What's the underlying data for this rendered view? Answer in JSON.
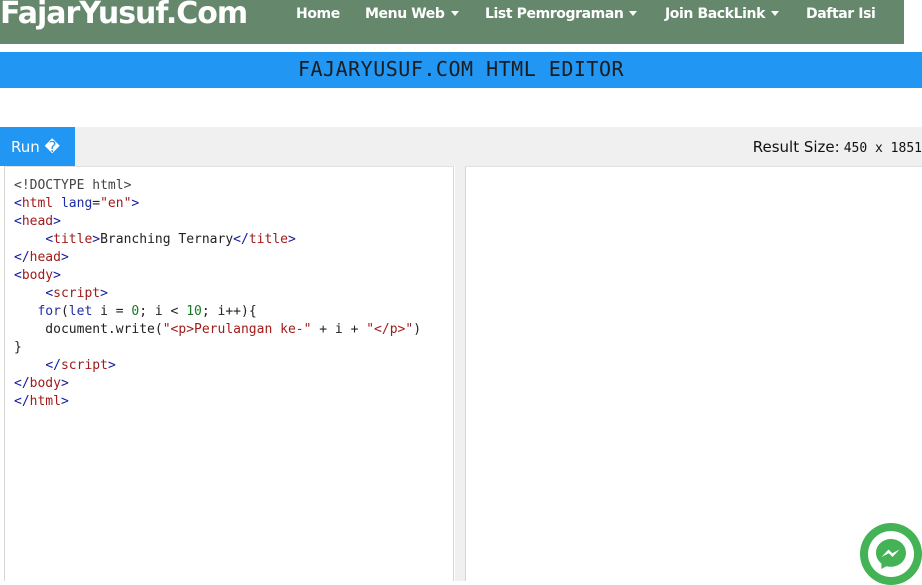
{
  "site": {
    "logo": "FajarYusuf.Com",
    "nav": [
      {
        "label": "Home",
        "dropdown": false
      },
      {
        "label": "Menu Web",
        "dropdown": true
      },
      {
        "label": "List Pemrograman",
        "dropdown": true
      },
      {
        "label": "Join BackLink",
        "dropdown": true
      },
      {
        "label": "Daftar Isi",
        "dropdown": false
      }
    ]
  },
  "editor": {
    "title": "FAJARYUSUF.COM HTML EDITOR",
    "run_label": "Run �",
    "result_size_label": "Result Size:",
    "result_size_value": "450 x 1851"
  },
  "code_lines": [
    [
      {
        "c": "doctype",
        "t": "<!DOCTYPE html>"
      }
    ],
    [
      {
        "c": "tag",
        "t": "<"
      },
      {
        "c": "tagname",
        "t": "html"
      },
      {
        "c": "plain",
        "t": " "
      },
      {
        "c": "attr",
        "t": "lang"
      },
      {
        "c": "plain",
        "t": "="
      },
      {
        "c": "str",
        "t": "\"en\""
      },
      {
        "c": "tag",
        "t": ">"
      }
    ],
    [
      {
        "c": "tag",
        "t": "<"
      },
      {
        "c": "tagname",
        "t": "head"
      },
      {
        "c": "tag",
        "t": ">"
      }
    ],
    [
      {
        "c": "plain",
        "t": "    "
      },
      {
        "c": "tag",
        "t": "<"
      },
      {
        "c": "tagname",
        "t": "title"
      },
      {
        "c": "tag",
        "t": ">"
      },
      {
        "c": "plain",
        "t": "Branching Ternary"
      },
      {
        "c": "tag",
        "t": "</"
      },
      {
        "c": "tagname",
        "t": "title"
      },
      {
        "c": "tag",
        "t": ">"
      }
    ],
    [
      {
        "c": "tag",
        "t": "</"
      },
      {
        "c": "tagname",
        "t": "head"
      },
      {
        "c": "tag",
        "t": ">"
      }
    ],
    [
      {
        "c": "tag",
        "t": "<"
      },
      {
        "c": "tagname",
        "t": "body"
      },
      {
        "c": "tag",
        "t": ">"
      }
    ],
    [
      {
        "c": "plain",
        "t": "    "
      },
      {
        "c": "tag",
        "t": "<"
      },
      {
        "c": "tagname",
        "t": "script"
      },
      {
        "c": "tag",
        "t": ">"
      }
    ],
    [
      {
        "c": "plain",
        "t": "   "
      },
      {
        "c": "kw",
        "t": "for"
      },
      {
        "c": "plain",
        "t": "("
      },
      {
        "c": "kw",
        "t": "let"
      },
      {
        "c": "plain",
        "t": " i = "
      },
      {
        "c": "num",
        "t": "0"
      },
      {
        "c": "plain",
        "t": "; i < "
      },
      {
        "c": "num",
        "t": "10"
      },
      {
        "c": "plain",
        "t": "; i++){"
      }
    ],
    [
      {
        "c": "plain",
        "t": "    document.write("
      },
      {
        "c": "str",
        "t": "\"<p>Perulangan ke-\""
      },
      {
        "c": "plain",
        "t": " + i + "
      },
      {
        "c": "str",
        "t": "\"</p>\""
      },
      {
        "c": "plain",
        "t": ")"
      }
    ],
    [
      {
        "c": "plain",
        "t": "}"
      }
    ],
    [
      {
        "c": "plain",
        "t": "    "
      },
      {
        "c": "tag",
        "t": "</"
      },
      {
        "c": "tagname",
        "t": "script"
      },
      {
        "c": "tag",
        "t": ">"
      }
    ],
    [
      {
        "c": "tag",
        "t": "</"
      },
      {
        "c": "tagname",
        "t": "body"
      },
      {
        "c": "tag",
        "t": ">"
      }
    ],
    [
      {
        "c": "tag",
        "t": "</"
      },
      {
        "c": "tagname",
        "t": "html"
      },
      {
        "c": "tag",
        "t": ">"
      }
    ]
  ],
  "icons": {
    "messenger": "messenger-chat-icon"
  },
  "colors": {
    "navbar": "#65876c",
    "accent": "#2196f3",
    "messenger": "#44b355"
  }
}
